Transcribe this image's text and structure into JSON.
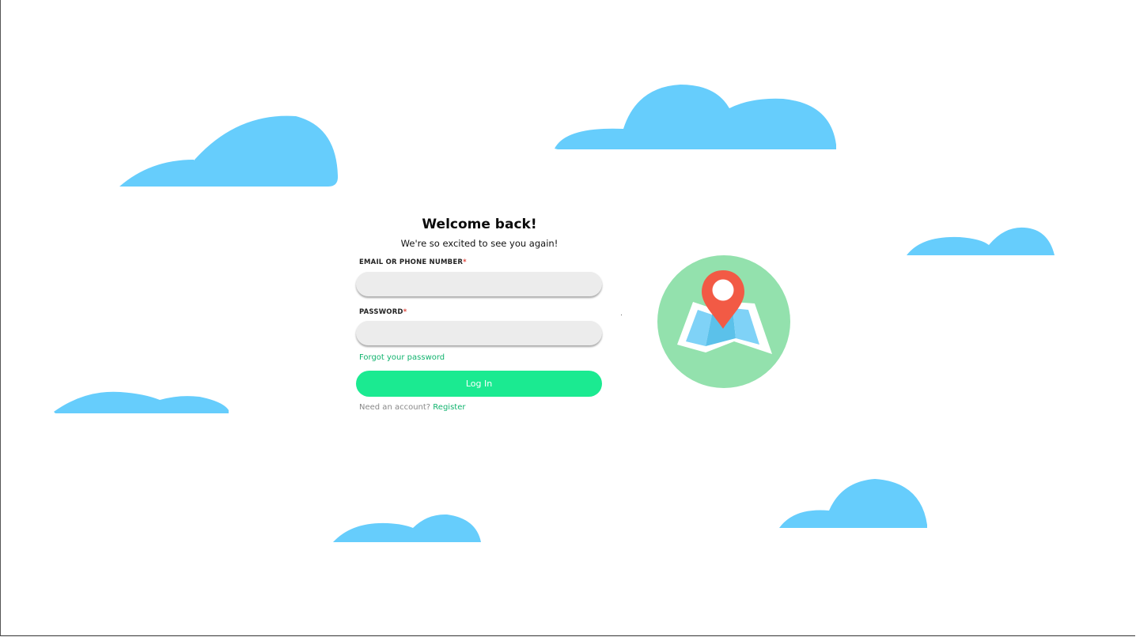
{
  "login": {
    "title": "Welcome back!",
    "subtitle": "We're so excited to see you again!",
    "email_label": "EMAIL OR PHONE NUMBER",
    "email_value": "",
    "password_label": "PASSWORD",
    "password_value": "",
    "required_mark": "*",
    "forgot_link": "Forgot your password",
    "login_button": "Log In",
    "need_account_text": "Need an account?",
    "register_link": "Register"
  },
  "colors": {
    "accent": "#1bea91",
    "link": "#11b36e",
    "required": "#e0453b",
    "cloud": "#66cdfc",
    "map_circle": "#93e1ad",
    "map_pin": "#f25a45"
  },
  "icons": [
    "cloud-icon",
    "map-pin-icon"
  ]
}
